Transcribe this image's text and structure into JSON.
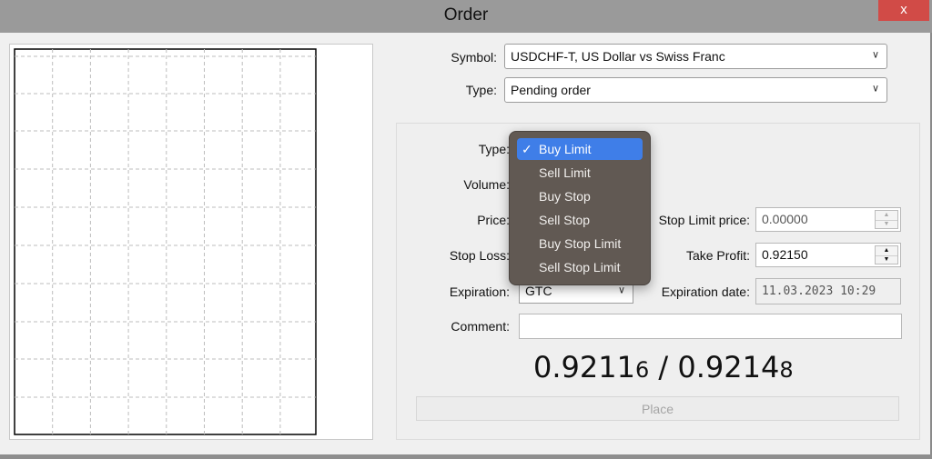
{
  "window": {
    "title": "Order",
    "close_label": "x"
  },
  "symbol": {
    "label": "Symbol:",
    "value": "USDCHF-T, US Dollar vs Swiss Franc"
  },
  "order_type": {
    "label": "Type:",
    "value": "Pending order"
  },
  "pending": {
    "type_label": "Type:",
    "type_options": [
      "Buy Limit",
      "Sell Limit",
      "Buy Stop",
      "Sell Stop",
      "Buy Stop Limit",
      "Sell Stop Limit"
    ],
    "type_selected": "Buy Limit",
    "volume_label": "Volume:",
    "price_label": "Price:",
    "stop_limit_label": "Stop Limit price:",
    "stop_limit_value": "0.00000",
    "stop_loss_label": "Stop Loss:",
    "take_profit_label": "Take Profit:",
    "take_profit_value": "0.92150",
    "expiration_label": "Expiration:",
    "expiration_value": "GTC",
    "expiration_date_label": "Expiration date:",
    "expiration_date_value": "11.03.2023 10:29",
    "comment_label": "Comment:",
    "comment_value": ""
  },
  "quote": {
    "bid_main": "0.9211",
    "bid_small": "6",
    "separator": " / ",
    "ask_main": "0.9214",
    "ask_small": "8"
  },
  "place_label": "Place",
  "icons": {
    "check": "✓",
    "chevron": "﹀",
    "up": "▲",
    "down": "▼"
  }
}
